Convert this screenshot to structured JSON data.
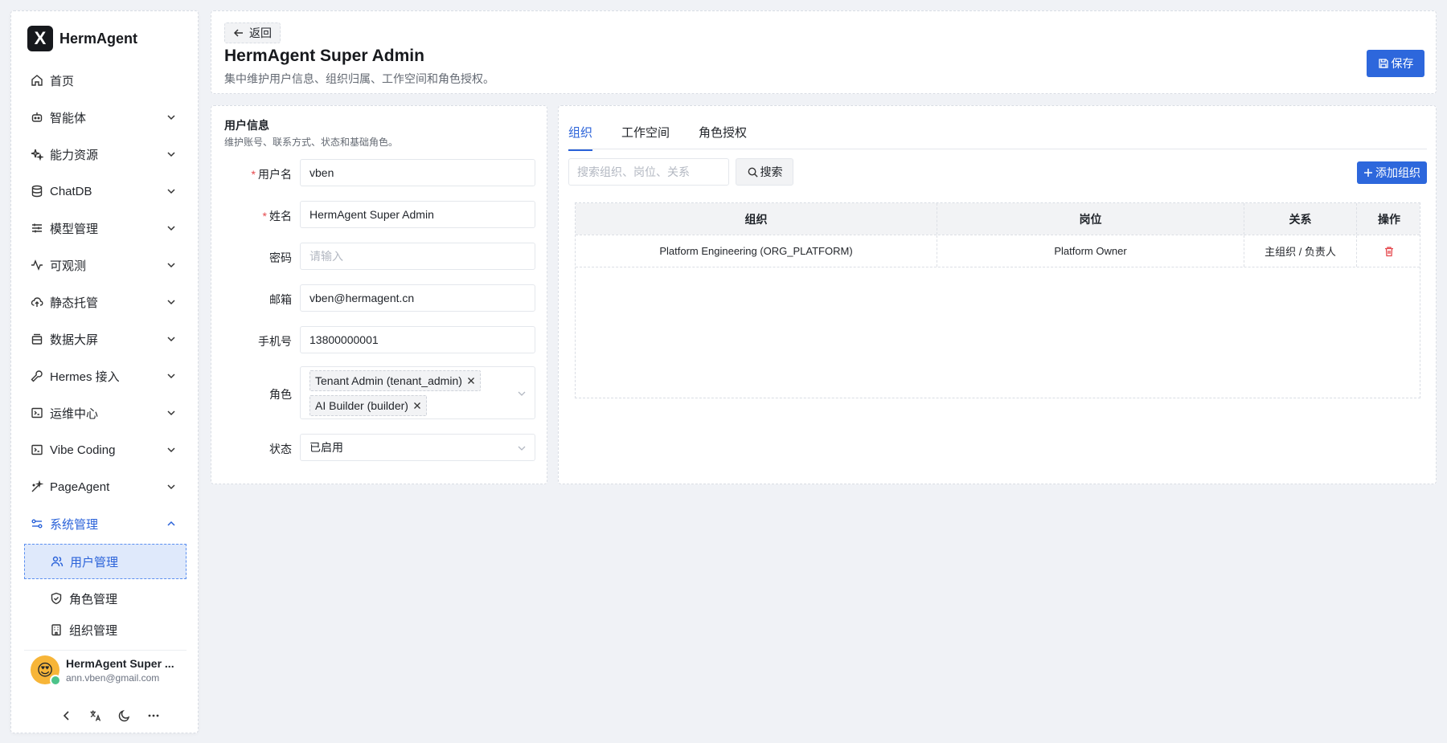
{
  "sidebar": {
    "brand": {
      "logo": "X",
      "name": "HermAgent"
    },
    "nav": [
      {
        "label": "首页",
        "icon": "home-icon",
        "chev": false
      },
      {
        "label": "智能体",
        "icon": "robot-icon",
        "chev": true
      },
      {
        "label": "能力资源",
        "icon": "sparkles-icon",
        "chev": true
      },
      {
        "label": "ChatDB",
        "icon": "database-icon",
        "chev": true
      },
      {
        "label": "模型管理",
        "icon": "sliders-icon",
        "chev": true
      },
      {
        "label": "可观测",
        "icon": "activity-icon",
        "chev": true
      },
      {
        "label": "静态托管",
        "icon": "cloud-upload-icon",
        "chev": true
      },
      {
        "label": "数据大屏",
        "icon": "screen-icon",
        "chev": true
      },
      {
        "label": "Hermes 接入",
        "icon": "wrench-icon",
        "chev": true
      },
      {
        "label": "运维中心",
        "icon": "terminal-icon",
        "chev": true
      },
      {
        "label": "Vibe Coding",
        "icon": "code-icon",
        "chev": true
      },
      {
        "label": "PageAgent",
        "icon": "magic-wand-icon",
        "chev": true
      },
      {
        "label": "系统管理",
        "icon": "settings-sliders-icon",
        "chev": true,
        "open": true
      }
    ],
    "sub_items": [
      {
        "label": "用户管理",
        "icon": "users-icon",
        "active": true
      },
      {
        "label": "角色管理",
        "icon": "shield-check-icon"
      },
      {
        "label": "组织管理",
        "icon": "building-icon"
      }
    ],
    "user": {
      "name": "HermAgent Super ...",
      "email": "ann.vben@gmail.com",
      "avatar": "😍"
    }
  },
  "header": {
    "back_label": "返回",
    "title": "HermAgent Super Admin",
    "description": "集中维护用户信息、组织归属、工作空间和角色授权。",
    "save_label": "保存"
  },
  "user_info": {
    "title": "用户信息",
    "subtitle": "维护账号、联系方式、状态和基础角色。",
    "fields": {
      "username": {
        "label": "用户名",
        "value": "vben",
        "required": "*"
      },
      "name": {
        "label": "姓名",
        "value": "HermAgent Super Admin",
        "required": "*"
      },
      "password": {
        "label": "密码",
        "placeholder": "请输入"
      },
      "email": {
        "label": "邮箱",
        "value": "vben@hermagent.cn"
      },
      "phone": {
        "label": "手机号",
        "value": "13800000001"
      },
      "roles": {
        "label": "角色",
        "tags": [
          "Tenant Admin (tenant_admin)",
          "AI Builder (builder)"
        ]
      },
      "status": {
        "label": "状态",
        "value": "已启用"
      }
    }
  },
  "relations": {
    "tabs": [
      "组织",
      "工作空间",
      "角色授权"
    ],
    "active_tab": 0,
    "search_placeholder": "搜索组织、岗位、关系",
    "search_label": "搜索",
    "add_label": "添加组织",
    "columns": [
      "组织",
      "岗位",
      "关系",
      "操作"
    ],
    "rows": [
      {
        "org": "Platform Engineering (ORG_PLATFORM)",
        "position": "Platform Owner",
        "relation": "主组织 / 负责人",
        "action_icon": "trash-icon"
      }
    ]
  },
  "colors": {
    "accent": "#2d67dc",
    "danger": "#e5484d",
    "active_bg": "#dfe9fb"
  }
}
